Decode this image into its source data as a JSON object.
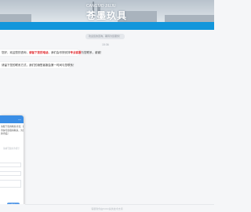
{
  "header": {
    "logo_main": "苍墨玖具",
    "logo_sub": "CANGMO JIUJU"
  },
  "chat": {
    "system_notice": "欢迎您的咨询，期待为您服务！",
    "timestamp": "15:36",
    "message1": {
      "prefix": "您好，欢迎您的咨询，",
      "highlight1": "请留下您的电话",
      "middle": "，我们会尽快安排",
      "highlight2": "专业客服",
      "suffix": "与您联系，谢谢！"
    },
    "message2": "请留下您的联系方式，我们的销售客服会第一时间与您联系！"
  },
  "form": {
    "description_line1": "请留下您的联系方式，我们的客服人员会",
    "description_line2": "尽快与您取得联系，为您提供报价，期待您",
    "description_line3": "的光临！",
    "note": "请填写您的手机号",
    "submit_label": "提交",
    "close_label": "—"
  },
  "footer": {
    "powered_by": "客服软件由53KF提供技术支持"
  },
  "colors": {
    "accent": "#1296db",
    "highlight": "#e0262b",
    "form_header": "#3a8ee6"
  }
}
